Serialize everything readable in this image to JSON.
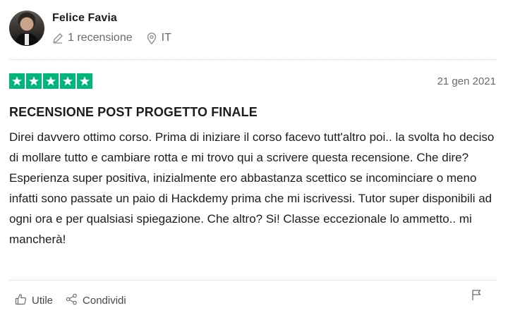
{
  "reviewer": {
    "name": "Felice Favia",
    "reviews_count": "1 recensione",
    "country": "IT"
  },
  "review": {
    "rating": 5,
    "date": "21 gen 2021",
    "title": "RECENSIONE POST PROGETTO FINALE",
    "text": "Direi davvero ottimo corso. Prima di iniziare il corso facevo tutt'altro poi.. la svolta ho deciso di mollare tutto e cambiare rotta e mi trovo qui a scrivere questa recensione. Che dire? Esperienza super positiva, inizialmente ero abbastanza scettico se incominciare o meno infatti sono passate un paio di Hackdemy prima che mi iscrivessi. Tutor super disponibili ad ogni ora e per qualsiasi spiegazione. Che altro? Si! Classe eccezionale lo ammetto.. mi mancherà!"
  },
  "actions": {
    "useful_label": "Utile",
    "share_label": "Condividi"
  },
  "colors": {
    "star_green": "#00b67a",
    "muted_text": "#696a6a",
    "divider": "#e5e5dd"
  },
  "icons": [
    "pencil-icon",
    "location-pin-icon",
    "star-icon",
    "thumbs-up-icon",
    "share-icon",
    "flag-icon"
  ]
}
